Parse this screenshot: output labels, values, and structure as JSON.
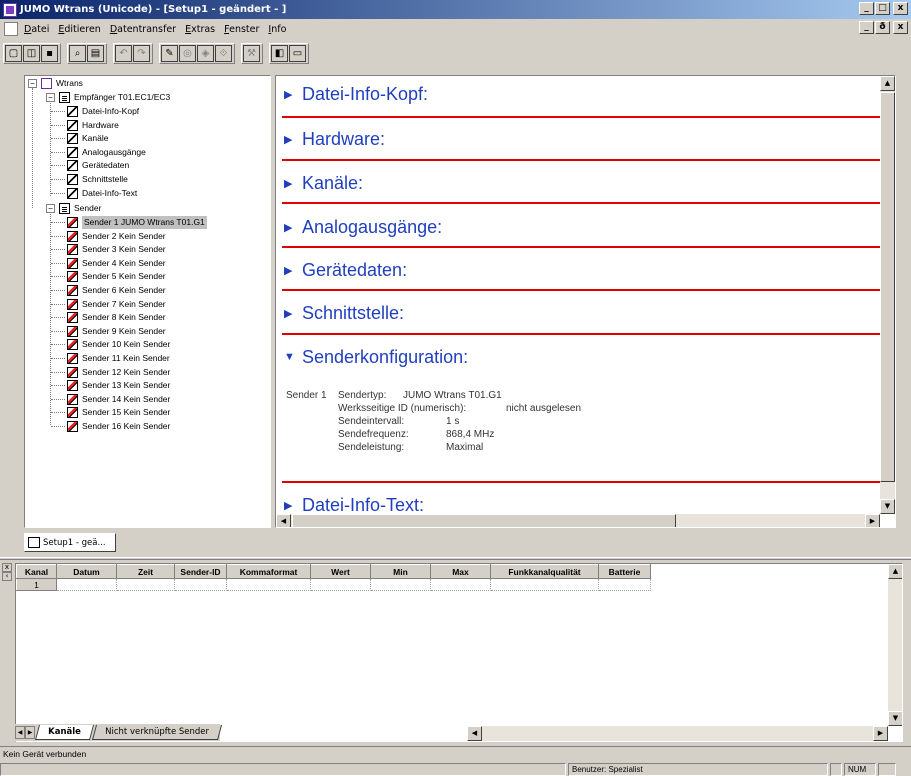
{
  "window": {
    "title": "JUMO Wtrans (Unicode) - [Setup1 - geändert - ]",
    "minimize": "_",
    "maximize": "□",
    "close": "x",
    "mdi_minimize": "_",
    "mdi_restore": "ð",
    "mdi_close": "x"
  },
  "menu": [
    "Datei",
    "Editieren",
    "Datentransfer",
    "Extras",
    "Fenster",
    "Info"
  ],
  "toolbar": {
    "icons": [
      "new-file-icon",
      "open-file-icon",
      "save-icon",
      "print-preview-icon",
      "print-icon",
      "undo-icon",
      "redo-icon",
      "read-device-icon",
      "write-device-icon",
      "transfer-icon",
      "settings-icon",
      "tools-icon",
      "view-split-icon",
      "view-horizontal-icon"
    ]
  },
  "tree": {
    "root": "Wtrans",
    "receiver": "Empfänger T01.EC1/EC3",
    "receiver_items": [
      "Datei-Info-Kopf",
      "Hardware",
      "Kanäle",
      "Analogausgänge",
      "Gerätedaten",
      "Schnittstelle",
      "Datei-Info-Text"
    ],
    "sender": "Sender",
    "sender_items": [
      "Sender 1 JUMO Wtrans T01.G1",
      "Sender 2  Kein Sender",
      "Sender 3  Kein Sender",
      "Sender 4  Kein Sender",
      "Sender 5  Kein Sender",
      "Sender 6  Kein Sender",
      "Sender 7  Kein Sender",
      "Sender 8  Kein Sender",
      "Sender 9  Kein Sender",
      "Sender 10  Kein Sender",
      "Sender 11  Kein Sender",
      "Sender 12  Kein Sender",
      "Sender 13  Kein Sender",
      "Sender 14  Kein Sender",
      "Sender 15  Kein Sender",
      "Sender 16  Kein Sender"
    ],
    "selected_index": 0
  },
  "content": {
    "sections": [
      {
        "label": "Datei-Info-Kopf:",
        "expanded": false
      },
      {
        "label": "Hardware:",
        "expanded": false
      },
      {
        "label": "Kanäle:",
        "expanded": false
      },
      {
        "label": "Analogausgänge:",
        "expanded": false
      },
      {
        "label": "Gerätedaten:",
        "expanded": false
      },
      {
        "label": "Schnittstelle:",
        "expanded": false
      },
      {
        "label": "Senderkonfiguration:",
        "expanded": true
      },
      {
        "label": "Datei-Info-Text:",
        "expanded": false
      }
    ],
    "arrow_collapsed": "▶",
    "arrow_expanded": "▼",
    "sender_detail": {
      "sender_label": "Sender 1",
      "type_label": "Sendertyp:",
      "type_value": "JUMO Wtrans T01.G1",
      "id_label": "Werksseitige ID (numerisch):",
      "id_value": "nicht ausgelesen",
      "interval_label": "Sendeintervall:",
      "interval_value": "1 s",
      "freq_label": "Sendefrequenz:",
      "freq_value": "868,4 MHz",
      "power_label": "Sendeleistung:",
      "power_value": "Maximal"
    }
  },
  "doc_tab": "Setup1 - geä...",
  "grid": {
    "columns": [
      "Kanal",
      "Datum",
      "Zeit",
      "Sender-ID",
      "Kommaformat",
      "Wert",
      "Min",
      "Max",
      "Funkkanalqualität",
      "Batterie"
    ],
    "rows": [
      [
        "1",
        "",
        "",
        "",
        "",
        "",
        "",
        "",
        "",
        ""
      ]
    ]
  },
  "sheet_tabs": [
    "Kanäle",
    "Nicht verknüpfte Sender"
  ],
  "status": {
    "connection": "Kein Gerät verbunden",
    "user": "Benutzer: Spezialist",
    "num": "NUM"
  },
  "colors": {
    "section_text": "#1f3fbf",
    "divider": "#e00000",
    "titlebar_start": "#0a246a",
    "titlebar_end": "#a6caf0"
  }
}
